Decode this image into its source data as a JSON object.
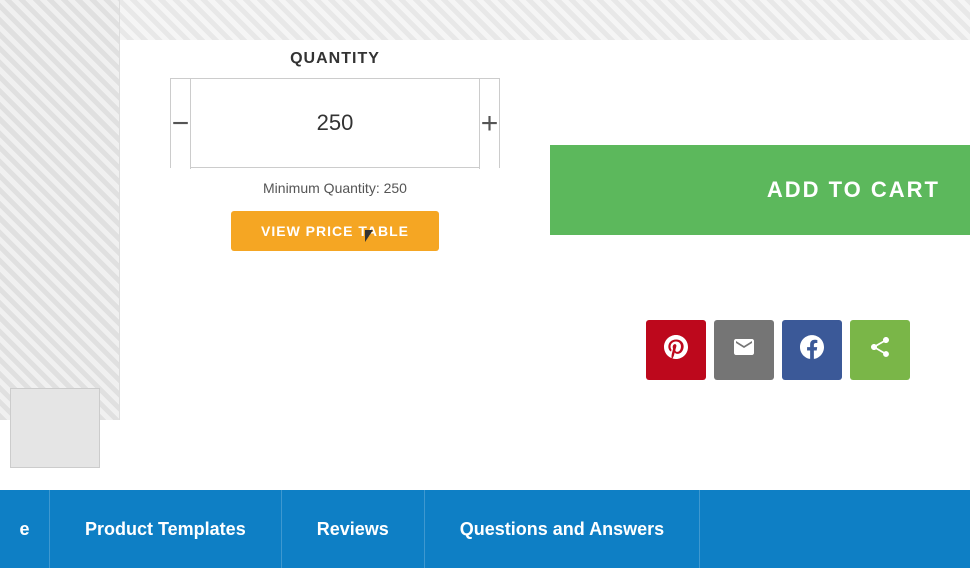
{
  "top_area": {
    "pattern": "hatched"
  },
  "quantity": {
    "label": "QUANTITY",
    "value": "250",
    "decrement_label": "−",
    "increment_label": "+",
    "min_qty_text": "Minimum Quantity: 250",
    "view_price_table_label": "VIEW PRICE TABLE"
  },
  "add_to_cart": {
    "label": "ADD TO CART"
  },
  "social_buttons": [
    {
      "name": "pinterest",
      "icon": "pinterest-icon",
      "label": "Pinterest",
      "color": "#bd081c"
    },
    {
      "name": "email",
      "icon": "email-icon",
      "label": "Email",
      "color": "#757575"
    },
    {
      "name": "facebook",
      "icon": "facebook-icon",
      "label": "Facebook",
      "color": "#3b5998"
    },
    {
      "name": "share",
      "icon": "share-icon",
      "label": "Share",
      "color": "#7ab648"
    }
  ],
  "tabs": [
    {
      "id": "tab-partial",
      "label": "e",
      "partial": true
    },
    {
      "id": "tab-product-templates",
      "label": "Product Templates"
    },
    {
      "id": "tab-reviews",
      "label": "Reviews"
    },
    {
      "id": "tab-qa",
      "label": "Questions and Answers"
    }
  ]
}
